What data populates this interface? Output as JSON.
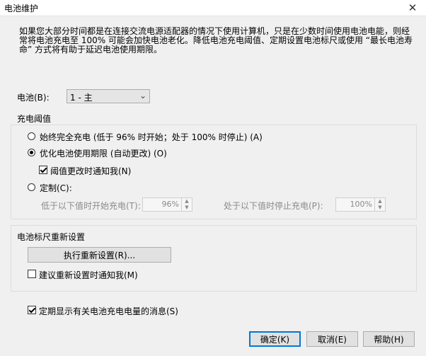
{
  "window": {
    "title": "电池维护",
    "close_glyph": "✕"
  },
  "description": "如果您大部分时间都是在连接交流电源适配器的情况下使用计算机，只是在少数时间使用电池电能，则经常将电池充电至 100% 可能会加快电池老化。降低电池充电阈值、定期设置电池标尺或使用 “最长电池寿命” 方式将有助于延迟电池使用期限。",
  "battery": {
    "label": "电池(B):",
    "selected": "1 - 主"
  },
  "charge_threshold": {
    "title": "充电阈值",
    "option_full": "始终完全充电 (低于 96% 时开始；处于 100% 时停止) (A)",
    "option_optimize": "优化电池使用期限 (自动更改) (O)",
    "notify_change": "阈值更改时通知我(N)",
    "option_custom": "定制(C):",
    "start_label": "低于以下值时开始充电(T):",
    "start_value": "96%",
    "stop_label": "处于以下值时停止充电(P):",
    "stop_value": "100%"
  },
  "gauge_reset": {
    "title": "电池标尺重新设置",
    "execute_button": "执行重新设置(R)...",
    "suggest_notify": "建议重新设置时通知我(M)"
  },
  "periodic_message": "定期显示有关电池充电电量的消息(S)",
  "buttons": {
    "ok": "确定(K)",
    "cancel": "取消(E)",
    "help": "帮助(H)"
  }
}
